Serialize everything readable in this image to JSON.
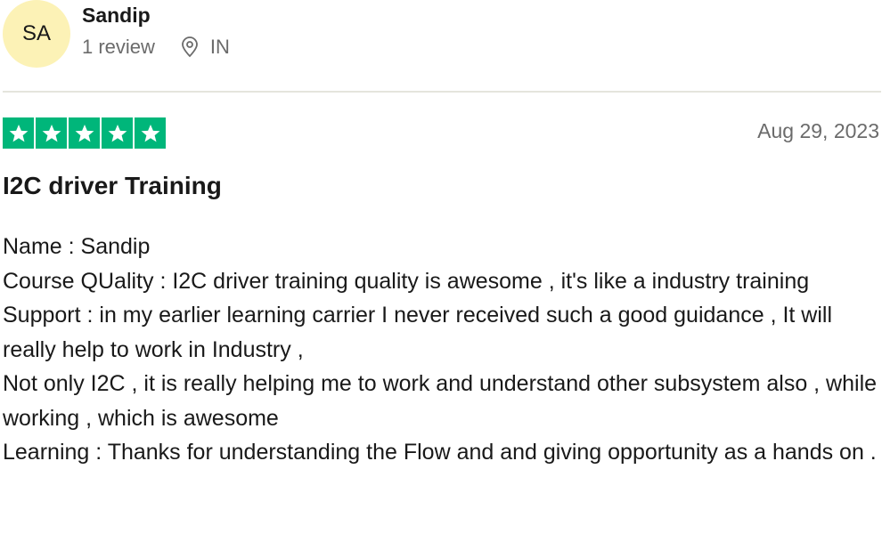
{
  "reviewer": {
    "initials": "SA",
    "name": "Sandip",
    "review_count": "1 review",
    "country": "IN",
    "avatar_color": "#fcf2b6"
  },
  "rating": {
    "stars": 5,
    "max": 5,
    "star_color": "#00b67a"
  },
  "review": {
    "date": "Aug 29, 2023",
    "title": "I2C driver Training",
    "lines": [
      "Name : Sandip",
      "Course QUality : I2C driver training quality is awesome , it's like a industry training",
      "Support : in my earlier learning carrier I never received such a good guidance , It will really help to work in Industry ,",
      "Not only I2C , it is really helping me to work and understand other subsystem also , while working , which is awesome",
      "Learning : Thanks for understanding the Flow and and giving opportunity as a hands on ."
    ]
  },
  "icons": {
    "location": "location-pin-icon",
    "star": "star-icon"
  }
}
